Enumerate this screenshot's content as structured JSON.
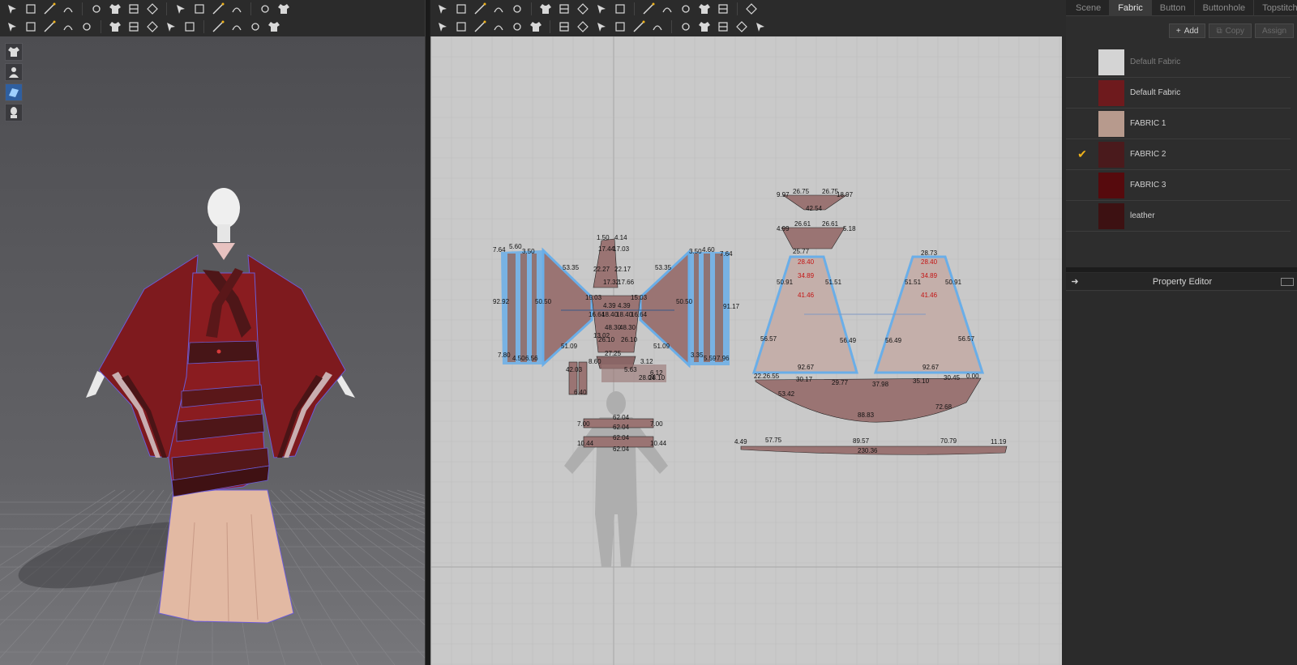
{
  "toolbars": {
    "left_row1": [
      "select-move-icon",
      "transform-icon",
      "box-select-icon",
      "scale-icon",
      "fold-icon",
      "sew-needle-icon",
      "pin-icon",
      "brush-icon",
      "tack-icon",
      "shirt-icon",
      "trousers-icon",
      "measure-icon",
      "lasso-icon",
      "ruler-icon"
    ],
    "left_row2": [
      "avatar-pose-icon",
      "arrangement-icon",
      "skeleton-icon",
      "bone-icon",
      "texture-icon",
      "puckering-icon",
      "strength-icon",
      "diamond-icon",
      "button-icon",
      "buttonhole-icon",
      "line-icon",
      "zipper-icon",
      "pipe-icon",
      "flag-icon"
    ],
    "right_row1": [
      "edit-pattern-icon",
      "transform-pattern-icon",
      "edit-curvature-icon",
      "curve-point-icon",
      "add-point-icon",
      "internal-shape-icon",
      "polygon-icon",
      "rectangle-icon",
      "circle-icon",
      "dart-icon",
      "internal-rect-icon",
      "internal-circle-icon",
      "trace-icon",
      "gradient-icon",
      "pleat-icon",
      "fold-arrangement-icon"
    ],
    "right_row2": [
      "segment-sewing-icon",
      "free-sewing-icon",
      "m-n-sewing-icon",
      "check-sewing-icon",
      "iron-icon",
      "garment-fit-icon",
      "sew-strength-icon",
      "pattern-fold-icon",
      "mirror-icon",
      "symmetric-icon",
      "snap-icon",
      "line-edit-icon",
      "dashed-line-icon",
      "wave-icon",
      "topstitch-icon",
      "grading-icon",
      "lock-pattern-icon"
    ]
  },
  "viewport3d": {
    "tools": [
      "garment-view-icon",
      "avatar-view-icon",
      "fabric-view-icon",
      "head-view-icon"
    ]
  },
  "pattern_labels": {
    "sleeve_left": [
      "7.64",
      "5.60",
      "3.50",
      "53.35",
      "50.50",
      "92.92",
      "7.80",
      "4.50",
      "6.56"
    ],
    "collar": [
      "1.50",
      "4.14",
      "17.44",
      "17.03",
      "22.27",
      "22.17",
      "17.32",
      "17.66",
      "15.03",
      "15.03",
      "4.39",
      "4.39",
      "16.64",
      "18.40",
      "18.40",
      "16.64",
      "48.30",
      "48.30",
      "26.10",
      "26.10",
      "51.09",
      "51.09",
      "13.02",
      "27.25"
    ],
    "sleeve_right": [
      "3.50",
      "4.60",
      "7.64",
      "53.35",
      "50.50",
      "91.17",
      "3.35",
      "5.59",
      "7.96"
    ],
    "small_parts": [
      "42.03",
      "6.40",
      "8.60",
      "3.12",
      "5.63",
      "6.12",
      "28.04",
      "28.10"
    ],
    "belt_strips": [
      "62.04",
      "7.00",
      "7.00",
      "62.04",
      "62.04",
      "10.44",
      "10.44",
      "62.04"
    ],
    "top_pieces": [
      "9.97",
      "26.75",
      "26.75",
      "18.97",
      "42.54",
      "4.99",
      "26.61",
      "26.61",
      "5.18",
      "25.77",
      "28.73"
    ],
    "skirt_panels": [
      "28.40",
      "34.89",
      "41.46",
      "50.91",
      "51.51",
      "56.57",
      "56.49",
      "92.67",
      "28.40",
      "34.89",
      "41.46",
      "51.51",
      "50.91",
      "56.49",
      "56.57",
      "92.67"
    ],
    "hem_piece": [
      "22.26.55",
      "30.17",
      "29.77",
      "37.98",
      "35.10",
      "30.45",
      "0.00",
      "53.42",
      "88.83",
      "72.68"
    ],
    "band": [
      "4.49",
      "57.75",
      "89.57",
      "70.79",
      "11.19",
      "230.36"
    ]
  },
  "right_panel": {
    "tabs": [
      "Scene",
      "Fabric",
      "Button",
      "Buttonhole",
      "Topstitch"
    ],
    "active_tab": "Fabric",
    "add_label": "Add",
    "copy_label": "Copy",
    "assign_label": "Assign",
    "fabrics": [
      {
        "name": "Default Fabric",
        "color": "#d4d4d4",
        "checked": false,
        "dim": true
      },
      {
        "name": "Default Fabric",
        "color": "#6e1a1d",
        "checked": false,
        "dim": false
      },
      {
        "name": "FABRIC 1",
        "color": "#b79a8d",
        "checked": false,
        "dim": false
      },
      {
        "name": "FABRIC 2",
        "color": "#4a1a1c",
        "checked": true,
        "dim": false
      },
      {
        "name": "FABRIC 3",
        "color": "#560a0d",
        "checked": false,
        "dim": false
      },
      {
        "name": "leather",
        "color": "#3d1112",
        "checked": false,
        "dim": false
      }
    ],
    "property_editor_title": "Property Editor"
  },
  "colors": {
    "robe": "#8a1c20",
    "robe_dark": "#5a1417",
    "underskirt": "#e3b8a1",
    "pattern_fill": "#9a7473",
    "pattern_fill_light": "#c4afaa",
    "selected_outline": "#6aaee8",
    "check": "#f0b31b"
  }
}
